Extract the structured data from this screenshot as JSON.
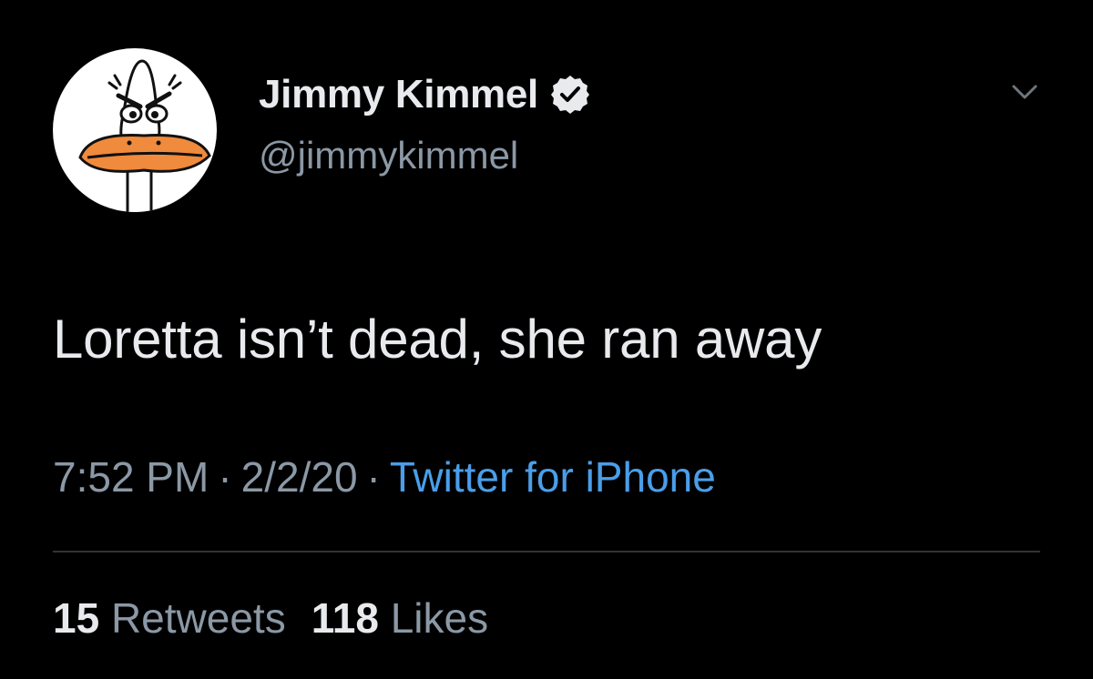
{
  "tweet": {
    "author": {
      "display_name": "Jimmy Kimmel",
      "handle": "@jimmykimmel",
      "verified": true,
      "avatar_icon": "angry-duck-avatar-icon"
    },
    "text": "Loretta isn’t dead, she ran away",
    "meta": {
      "time": "7:52 PM",
      "separator": "·",
      "date": "2/2/20",
      "source": "Twitter for iPhone"
    },
    "stats": {
      "retweets_count": "15",
      "retweets_label": "Retweets",
      "likes_count": "118",
      "likes_label": "Likes"
    },
    "menu_icon": "chevron-down-icon"
  },
  "colors": {
    "background": "#000000",
    "primary_text": "#e8eaed",
    "secondary_text": "#8b98a5",
    "link": "#4a9ee9",
    "divider": "#2f3336",
    "beak": "#f08a3c"
  }
}
